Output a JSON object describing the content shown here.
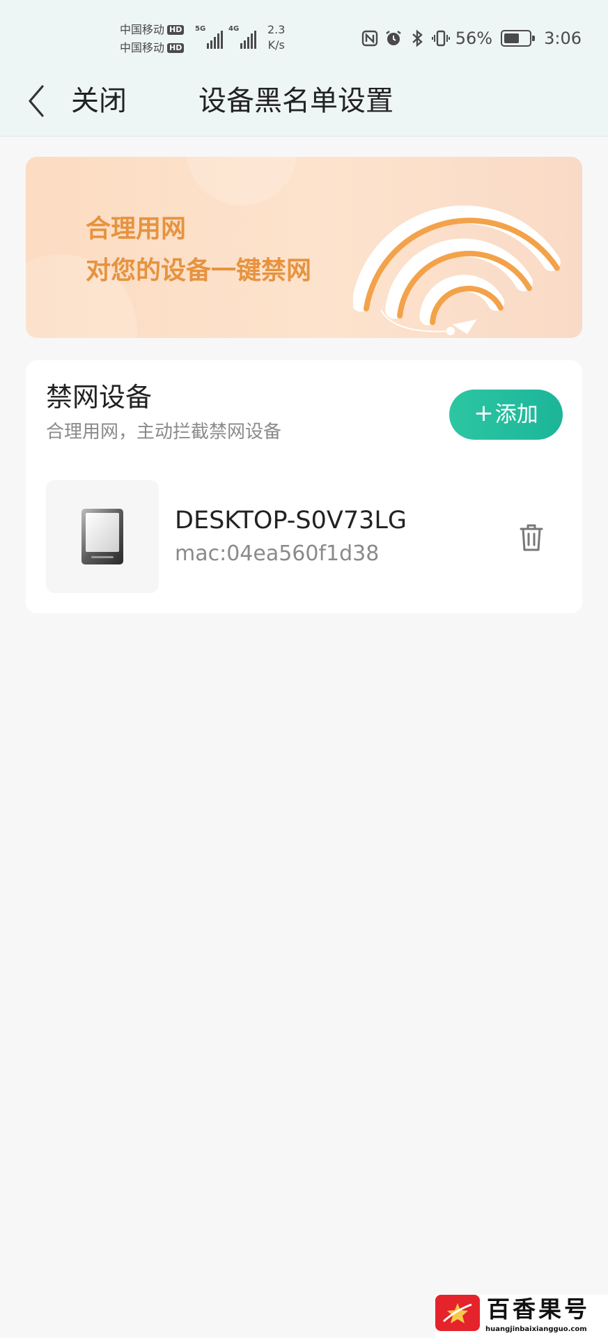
{
  "status_bar": {
    "carrier_1": "中国移动",
    "carrier_2": "中国移动",
    "hd_badge": "HD",
    "network_1": "5G",
    "network_2": "4G",
    "speed_value": "2.3",
    "speed_unit": "K/s",
    "battery_percent": "56%",
    "time": "3:06"
  },
  "header": {
    "close_label": "关闭",
    "title": "设备黑名单设置"
  },
  "banner": {
    "line_1": "合理用网",
    "line_2": "对您的设备一键禁网"
  },
  "blocked_devices": {
    "title": "禁网设备",
    "subtitle": "合理用网，主动拦截禁网设备",
    "add_label": "添加",
    "devices": [
      {
        "name": "DESKTOP-S0V73LG",
        "mac": "mac:04ea560f1d38"
      }
    ]
  },
  "watermark": {
    "name": "百香果号",
    "url": "huangjinbaixiangguo.com"
  },
  "colors": {
    "accent": "#1fb99b",
    "banner_text": "#e69340",
    "header_bg": "#eef5f5",
    "page_bg": "#f7f7f7"
  },
  "icons": [
    "nfc-icon",
    "alarm-icon",
    "bluetooth-icon",
    "vibrate-icon",
    "battery-icon",
    "back-chevron-icon",
    "wifi-illustration",
    "plus-icon",
    "device-icon",
    "trash-icon"
  ]
}
